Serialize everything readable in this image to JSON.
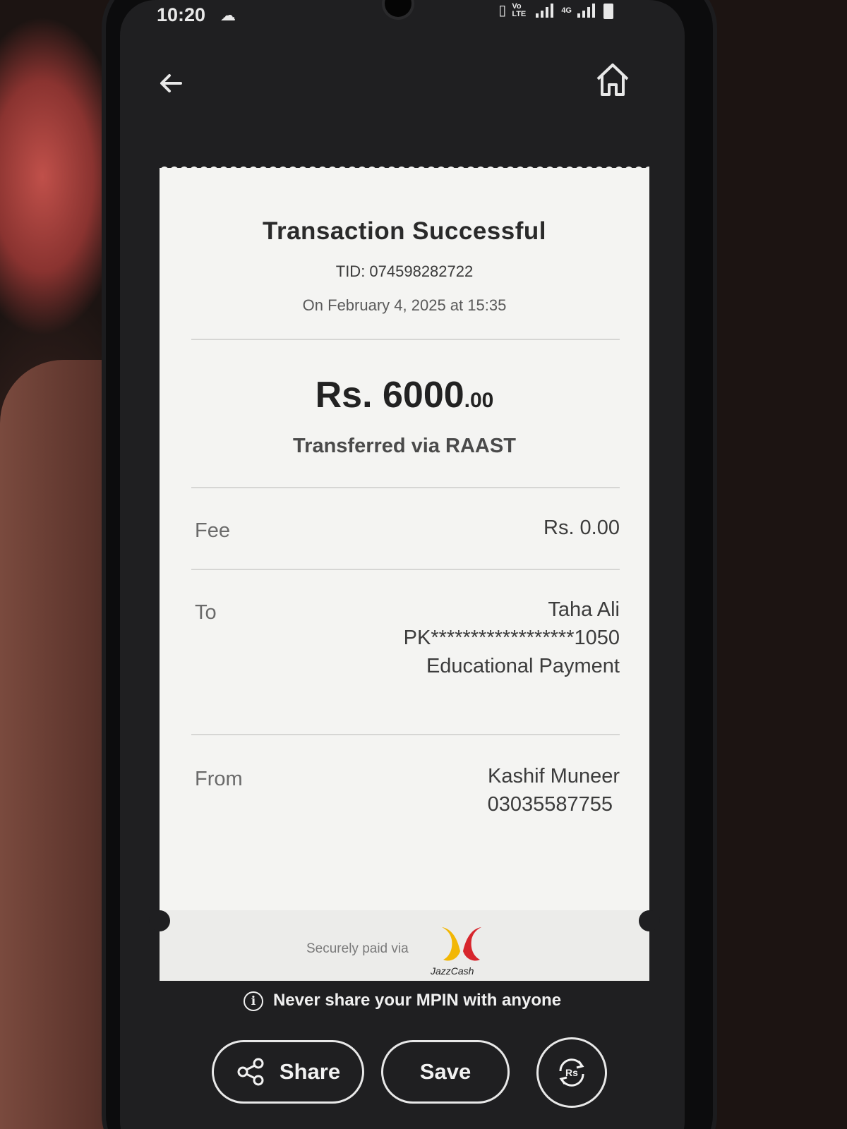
{
  "status_bar": {
    "time": "10:20",
    "network_labels": [
      "Vo LTE",
      "4G"
    ]
  },
  "nav": {
    "back_icon": "arrow-left-icon",
    "home_icon": "home-icon"
  },
  "receipt": {
    "title": "Transaction Successful",
    "tid": "TID: 074598282722",
    "date": "On February 4, 2025 at 15:35",
    "amount_main": "Rs. 6000",
    "amount_cents": ".00",
    "method": "Transferred via RAAST",
    "fee": {
      "label": "Fee",
      "value": "Rs. 0.00"
    },
    "to": {
      "label": "To",
      "name": "Taha Ali",
      "account": "PK******************1050",
      "purpose": "Educational Payment"
    },
    "from": {
      "label": "From",
      "name": "Kashif Muneer",
      "number": "03035587755"
    },
    "secure_text": "Securely paid via",
    "brand": "JazzCash"
  },
  "warning": "Never share your MPIN with anyone",
  "actions": {
    "share_label": "Share",
    "save_label": "Save",
    "repeat_label": "Rs"
  },
  "colors": {
    "receipt_bg": "#f4f4f2",
    "screen_bg": "#1f1f21",
    "jazz_yellow": "#f2b705",
    "jazz_red": "#d7262d"
  }
}
